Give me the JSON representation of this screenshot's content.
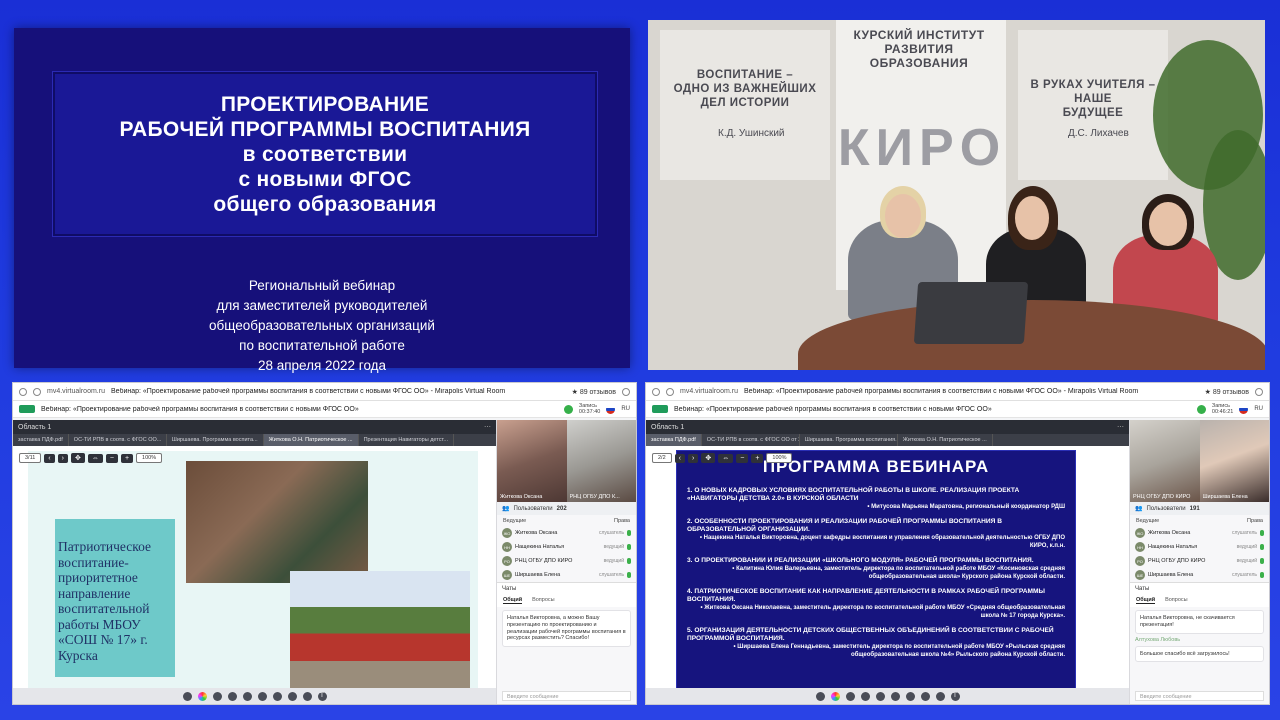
{
  "title_slide": {
    "title_lines": [
      "ПРОЕКТИРОВАНИЕ",
      "РАБОЧЕЙ ПРОГРАММЫ ВОСПИТАНИЯ",
      "в соответствии",
      "с новыми ФГОС",
      "общего образования"
    ],
    "subtitle_lines": [
      "Региональный вебинар",
      "для заместителей руководителей",
      "общеобразовательных организаций",
      "по воспитательной работе",
      "28 апреля 2022 года"
    ]
  },
  "photo": {
    "wall_left_lines": [
      "ВОСПИТАНИЕ –",
      "ОДНО ИЗ ВАЖНЕЙШИХ",
      "ДЕЛ ИСТОРИИ"
    ],
    "wall_left_author": "К.Д. Ушинский",
    "wall_center_lines": [
      "КУРСКИЙ ИНСТИТУТ",
      "РАЗВИТИЯ ОБРАЗОВАНИЯ"
    ],
    "logo_letters": [
      "К",
      "И",
      "Р",
      "О"
    ],
    "wall_right_lines": [
      "В РУКАХ УЧИТЕЛЯ –",
      "НАШЕ",
      "БУДУЩЕЕ"
    ],
    "wall_right_author": "Д.С. Лихачев"
  },
  "browser_left": {
    "url": "mv4.virtualroom.ru",
    "page_title": "Вебинар: «Проектирование рабочей программы воспитания в соответствии с новыми ФГОС ОО» - Mirapolis Virtual Room",
    "reviews": "★ 89 отзывов",
    "webinar_title": "Вебинар: «Проектирование рабочей программы воспитания в соответствии с новыми ФГОС ОО»",
    "rec_label": "Запись",
    "rec_time": "00:37:40",
    "lang": "RU",
    "area_label": "Область 1",
    "tabs": [
      "заставка ПДФ.pdf",
      "ОС-ТИ РПВ в соотв. с ФГОС ОО...",
      "Ширшаева. Программа воспита...",
      "Житкова О.Н. Патриотическое ...",
      "Презентация Навигаторы детст..."
    ],
    "active_tab": 3,
    "page_input": "3/11",
    "zoom": "100%",
    "slide_text": "Патриотическое воспитание-приоритетное направление воспитательной работы МБОУ «СОШ № 17» г. Курска",
    "cam1_name": "Житкова Оксана",
    "cam2_name": "РНЦ ОГБУ ДПО К...",
    "users_label": "Пользователи",
    "users_count": "202",
    "section_label": "Ведущие",
    "section_right": "Права",
    "users": [
      {
        "initials": "ЖО",
        "name": "Житкова Оксана",
        "role": "слушатель"
      },
      {
        "initials": "НН",
        "name": "Нащекина Наталья",
        "role": "ведущий"
      },
      {
        "initials": "РО",
        "name": "РНЦ ОГБУ ДПО КИРО",
        "role": "ведущий"
      },
      {
        "initials": "ШЕ",
        "name": "Ширшаева Елена",
        "role": "слушатель"
      }
    ],
    "chats_label": "Чаты",
    "chat_tabs": [
      "Общий",
      "Вопросы"
    ],
    "chat_message": "Наталья Викторовна, а можно Вашу презентацию по проектированию и реализации рабочей программы воспитания в ресурсах разместить? Спасибо!",
    "chat_placeholder": "Введите сообщение"
  },
  "browser_right": {
    "url": "mv4.virtualroom.ru",
    "page_title": "Вебинар: «Проектирование рабочей программы воспитания в соответствии с новыми ФГОС ОО» - Mirapolis Virtual Room",
    "reviews": "★ 89 отзывов",
    "webinar_title": "Вебинар: «Проектирование рабочей программы воспитания в соответствии с новыми ФГОС ОО»",
    "rec_label": "Запись",
    "rec_time": "00:46:21",
    "lang": "RU",
    "area_label": "Область 1",
    "tabs": [
      "заставка ПДФ.pdf",
      "ОС-ТИ РПВ в соотв. с ФГОС ОО от 2023 г...",
      "Ширшаева. Программа воспитания. Моду...",
      "Житкова О.Н. Патриотическое ..."
    ],
    "active_tab": 0,
    "page_input": "2/2",
    "zoom": "100%",
    "program_title": "ПРОГРАММА ВЕБИНАРА",
    "program_items": [
      {
        "h": "1. О НОВЫХ КАДРОВЫХ УСЛОВИЯХ ВОСПИТАТЕЛЬНОЙ РАБОТЫ В ШКОЛЕ. РЕАЛИЗАЦИЯ ПРОЕКТА «НАВИГАТОРЫ ДЕТСТВА 2.0» В КУРСКОЙ ОБЛАСТИ",
        "s": "• Митусова Марьяна Маратовна, региональный координатор РДШ"
      },
      {
        "h": "2. ОСОБЕННОСТИ ПРОЕКТИРОВАНИЯ И РЕАЛИЗАЦИИ РАБОЧЕЙ ПРОГРАММЫ ВОСПИТАНИЯ В ОБРАЗОВАТЕЛЬНОЙ ОРГАНИЗАЦИИ.",
        "s": "• Нащекина Наталья Викторовна, доцент кафедры воспитания и управления образовательной деятельностью ОГБУ ДПО КИРО, к.п.н."
      },
      {
        "h": "3. О ПРОЕКТИРОВАНИИ И РЕАЛИЗАЦИИ «ШКОЛЬНОГО МОДУЛЯ» РАБОЧЕЙ ПРОГРАММЫ ВОСПИТАНИЯ.",
        "s": "• Калитина Юлия Валерьевна, заместитель директора по воспитательной работе МБОУ «Косиновская средняя общеобразовательная школа» Курского района Курской области."
      },
      {
        "h": "4. ПАТРИОТИЧЕСКОЕ ВОСПИТАНИЕ КАК НАПРАВЛЕНИЕ ДЕЯТЕЛЬНОСТИ В РАМКАХ РАБОЧЕЙ ПРОГРАММЫ ВОСПИТАНИЯ.",
        "s": "• Житкова Оксана Николаевна, заместитель директора по воспитательной работе МБОУ «Средняя общеобразовательная школа № 17 города Курска»."
      },
      {
        "h": "5. ОРГАНИЗАЦИЯ ДЕЯТЕЛЬНОСТИ ДЕТСКИХ ОБЩЕСТВЕННЫХ ОБЪЕДИНЕНИЙ В СООТВЕТСТВИИ С РАБОЧЕЙ ПРОГРАММОЙ ВОСПИТАНИЯ.",
        "s": "• Ширшаева Елена Геннадьевна, заместитель директора по воспитательной работе МБОУ «Рыльская средняя общеобразовательная школа №4» Рыльского района Курской области."
      }
    ],
    "cam1_name": "РНЦ ОГБУ ДПО КИРО",
    "cam2_name": "Ширшаева Елена",
    "users_label": "Пользователи",
    "users_count": "191",
    "section_label": "Ведущие",
    "section_right": "Права",
    "users": [
      {
        "initials": "ЖО",
        "name": "Житкова Оксана",
        "role": "слушатель"
      },
      {
        "initials": "НН",
        "name": "Нащекина Наталья",
        "role": "ведущий"
      },
      {
        "initials": "РО",
        "name": "РНЦ ОГБУ ДПО КИРО",
        "role": "ведущий"
      },
      {
        "initials": "ШЕ",
        "name": "Ширшаева Елена",
        "role": "слушатель"
      }
    ],
    "chats_label": "Чаты",
    "chat_tabs": [
      "Общий",
      "Вопросы"
    ],
    "chat_message": "Наталья Викторовна, не скачивается презентация!",
    "chat_author": "Алтухова Любовь",
    "chat_message2": "Большое спасибо всё загрузилось!",
    "chat_placeholder": "Введите сообщение"
  }
}
